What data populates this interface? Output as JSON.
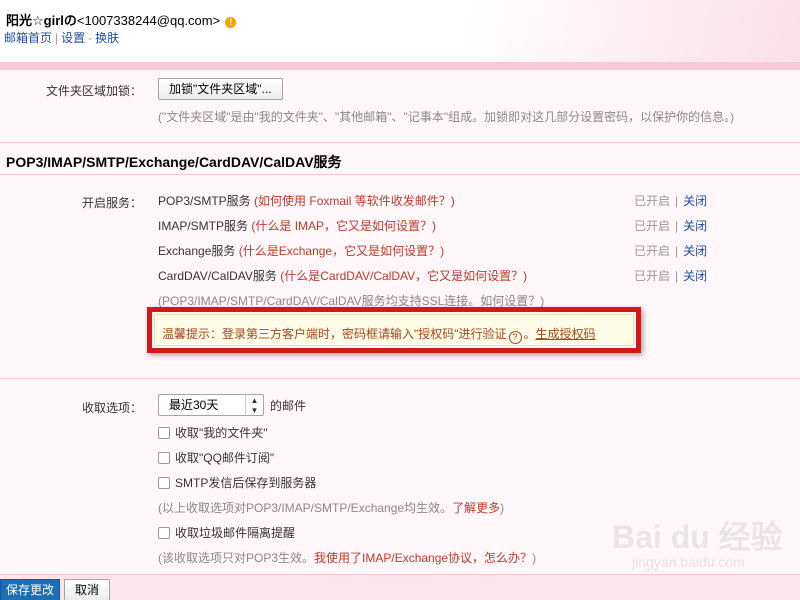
{
  "header": {
    "user_name": "阳光☆girlの",
    "user_email": "<1007338244@qq.com>",
    "warn_icon": "!",
    "nav": {
      "home": "邮箱首页",
      "sep": "|",
      "settings": "设置",
      "dash": "-",
      "skin": "换肤"
    }
  },
  "folder_lock": {
    "label": "文件夹区域加锁：",
    "button": "加锁\"文件夹区域\"...",
    "note": "(\"文件夹区域\"是由\"我的文件夹\"、\"其他邮箱\"、\"记事本\"组成。加锁即对这几部分设置密码，以保护你的信息。)"
  },
  "services": {
    "title": "POP3/IMAP/SMTP/Exchange/CardDAV/CalDAV服务",
    "label": "开启服务：",
    "status_on": "已开启",
    "status_sep": "|",
    "status_off": "关闭",
    "items": [
      {
        "name": "POP3/SMTP服务",
        "help": "(如何使用 Foxmail 等软件收发邮件？)"
      },
      {
        "name": "IMAP/SMTP服务",
        "help": "(什么是 IMAP，它又是如何设置？)"
      },
      {
        "name": "Exchange服务",
        "help": "(什么是Exchange，它又是如何设置？)"
      },
      {
        "name": "CardDAV/CalDAV服务",
        "help": "(什么是CardDAV/CalDAV，它又是如何设置？)"
      }
    ],
    "ssl_note": "(POP3/IMAP/SMTP/CardDAV/CalDAV服务均支持SSL连接。如何设置？)"
  },
  "tip": {
    "text": "温馨提示：登录第三方客户端时，密码框请输入\"授权码\"进行验证",
    "q_icon": "?",
    "period": "。",
    "link": "生成授权码"
  },
  "receive": {
    "label": "收取选项：",
    "select_value": "最近30天",
    "select_suffix": "的邮件",
    "options": [
      "收取\"我的文件夹\"",
      "收取\"QQ邮件订阅\"",
      "SMTP发信后保存到服务器"
    ],
    "note1": "(以上收取选项对POP3/IMAP/SMTP/Exchange均生效。",
    "note1_link": "了解更多",
    "note1_end": ")",
    "option_spam": "收取垃圾邮件隔离提醒",
    "note2_prefix": "(该收取选项只对POP3生效。",
    "note2_red": "我使用了IMAP/Exchange协议，怎么办？",
    "note2_end": ")"
  },
  "footer": {
    "save": "保存更改",
    "cancel": "取消"
  },
  "watermark": {
    "text": "Bai du 经验",
    "sub": "jingyan.baidu.com"
  },
  "colors": {
    "accent": "#1a6fb8",
    "highlight_border": "#d41818",
    "pink": "#f6c9d6"
  }
}
